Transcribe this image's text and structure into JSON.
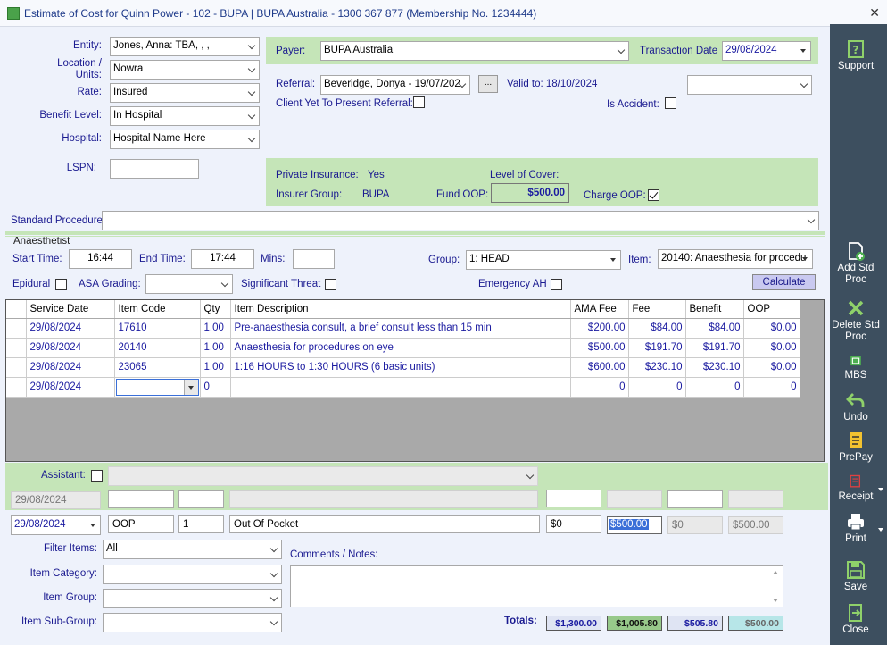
{
  "window": {
    "title": "Estimate of Cost for Quinn Power - 102 - BUPA | BUPA Australia - 1300 367 877 (Membership No. 1234444)",
    "close": "✕"
  },
  "left": {
    "entity_label": "Entity:",
    "entity": "Jones, Anna: TBA, , ,",
    "location_label": "Location / Units:",
    "location": "Nowra",
    "rate_label": "Rate:",
    "rate": "Insured",
    "benefit_label": "Benefit Level:",
    "benefit": "In Hospital",
    "hospital_label": "Hospital:",
    "hospital": "Hospital Name Here",
    "lspn_label": "LSPN:",
    "lspn": ""
  },
  "payer": {
    "payer_label": "Payer:",
    "payer": "BUPA Australia",
    "transaction_label": "Transaction Date",
    "transaction_date": "29/08/2024",
    "referral_label": "Referral:",
    "referral": "Beveridge, Donya - 19/07/202",
    "referral_btn": "...",
    "valid_to": "Valid to: 18/10/2024",
    "yet_to_present_label": "Client Yet To Present Referral:",
    "is_accident_label": "Is Accident:",
    "extra_dropdown": ""
  },
  "insurance": {
    "private_label": "Private Insurance:",
    "private_value": "Yes",
    "level_label": "Level of Cover:",
    "group_label": "Insurer Group:",
    "group_value": "BUPA",
    "fund_oop_label": "Fund OOP:",
    "fund_oop": "$500.00",
    "charge_oop_label": "Charge OOP:"
  },
  "standard_procedure_label": "Standard Procedure:",
  "anaesthetist": {
    "heading": "Anaesthetist",
    "start_label": "Start Time:",
    "start": "16:44",
    "end_label": "End Time:",
    "end": "17:44",
    "mins_label": "Mins:",
    "mins": "",
    "group_label": "Group:",
    "group": "1: HEAD",
    "item_label": "Item:",
    "item": "20140: Anaesthesia for procedu",
    "epidural_label": "Epidural",
    "asa_label": "ASA Grading:",
    "significant_label": "Significant Threat",
    "emergency_label": "Emergency AH",
    "calculate": "Calculate"
  },
  "grid": {
    "columns": [
      "Service Date",
      "Item Code",
      "Qty",
      "Item Description",
      "AMA Fee",
      "Fee",
      "Benefit",
      "OOP"
    ],
    "rows": [
      [
        "29/08/2024",
        "17610",
        "1.00",
        "Pre-anaesthesia consult, a brief consult less than 15 min",
        "$200.00",
        "$84.00",
        "$84.00",
        "$0.00"
      ],
      [
        "29/08/2024",
        "20140",
        "1.00",
        "Anaesthesia for procedures on eye",
        "$500.00",
        "$191.70",
        "$191.70",
        "$0.00"
      ],
      [
        "29/08/2024",
        "23065",
        "1.00",
        "1:16 HOURS to 1:30 HOURS (6 basic units)",
        "$600.00",
        "$230.10",
        "$230.10",
        "$0.00"
      ]
    ],
    "new_row": {
      "date": "29/08/2024",
      "qty": "0",
      "ama": "0",
      "fee": "0",
      "benefit": "0",
      "oop": "0"
    }
  },
  "assistant": {
    "label": "Assistant:",
    "date": "29/08/2024"
  },
  "oop_row": {
    "date": "29/08/2024",
    "code": "OOP",
    "qty": "1",
    "description": "Out Of Pocket",
    "ama": "$0",
    "fee": "$500.00",
    "benefit": "$0",
    "oop": "$500.00"
  },
  "filters": {
    "filter_label": "Filter Items:",
    "filter": "All",
    "category_label": "Item Category:",
    "group_label": "Item Group:",
    "subgroup_label": "Item Sub-Group:",
    "comments_label": "Comments / Notes:"
  },
  "totals": {
    "label": "Totals:",
    "ama": "$1,300.00",
    "fee": "$1,005.80",
    "benefit": "$505.80",
    "oop": "$500.00"
  },
  "sidebar": {
    "support": "Support",
    "add_std": "Add Std Proc",
    "delete_std": "Delete Std Proc",
    "mbs": "MBS",
    "undo": "Undo",
    "prepay": "PrePay",
    "receipt": "Receipt",
    "print": "Print",
    "save": "Save",
    "close": "Close"
  },
  "colors": {
    "panel_green": "#c5e5b8",
    "sidebar": "#3d4f5f",
    "label_blue": "#1a1a90"
  }
}
